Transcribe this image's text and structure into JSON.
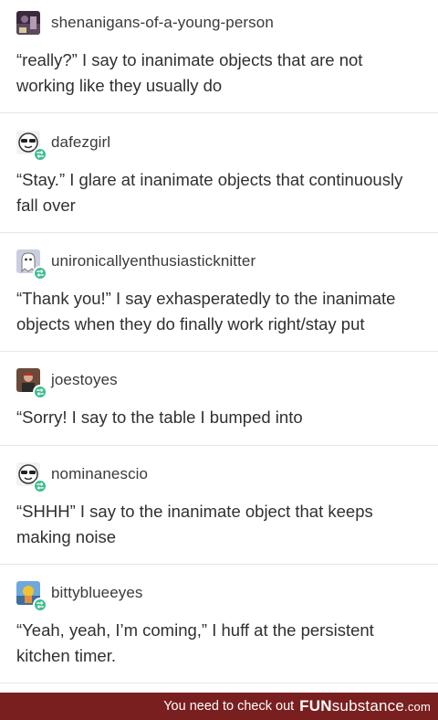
{
  "posts": [
    {
      "username": "shenanigans-of-a-young-person",
      "text": "“really?” I say to inanimate objects that are not working like they usually do",
      "avatar_icon": "dark-photo-avatar",
      "reblogged": false
    },
    {
      "username": "dafezgirl",
      "text": "“Stay.” I glare at inanimate objects that continuously fall over",
      "avatar_icon": "sunglasses-face-avatar",
      "reblogged": true
    },
    {
      "username": "unironicallyenthusiasticknitter",
      "text": "“Thank you!” I say exhasperatedly to the inanimate objects when they do finally work right/stay put",
      "avatar_icon": "ghost-cat-avatar",
      "reblogged": true
    },
    {
      "username": "joestoyes",
      "text": "“Sorry! I say to the table I bumped into",
      "avatar_icon": "person-photo-avatar",
      "reblogged": true
    },
    {
      "username": "nominanescio",
      "text": "“SHHH” I say to the inanimate object that keeps making noise",
      "avatar_icon": "sunglasses-face-avatar",
      "reblogged": true
    },
    {
      "username": "bittyblueeyes",
      "text": "“Yeah, yeah, I’m coming,” I huff at the persistent kitchen timer.",
      "avatar_icon": "cartoon-avatar",
      "reblogged": true
    }
  ],
  "footer": {
    "message": "You need to check out",
    "brand_part1": "FUN",
    "brand_part2": "substance",
    "brand_part3": ".com"
  },
  "colors": {
    "reblog_badge": "#3fbe8f",
    "footer_bg": "#7a1f1f",
    "divider": "#e6e6e6"
  }
}
